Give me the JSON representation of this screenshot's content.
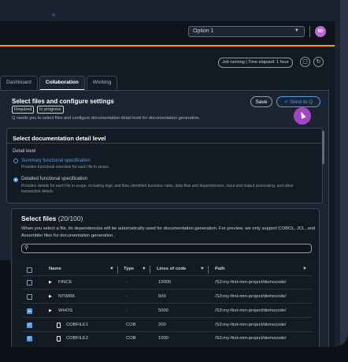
{
  "topbar": {
    "option_value": "Option 1",
    "avatar_initials": "SD"
  },
  "status": {
    "job": "Job running  |  Time elapsed: 1 hour"
  },
  "tabs": [
    "Dashboard",
    "Collaboration",
    "Worklog"
  ],
  "select_section": {
    "title": "Select files and configure settings",
    "badges": [
      "Required",
      "In progress"
    ],
    "description": "Q needs you to select files and configure documentation detail level for documentation generation.",
    "save_label": "Save",
    "send_label": "Send to Q"
  },
  "doc_level": {
    "title": "Select documentation detail level",
    "detail_label": "Detail level",
    "options": [
      {
        "label": "Summary functional specification",
        "desc": "Provides functional overview for each file in scope."
      },
      {
        "label": "Detailed functional specification",
        "desc": "Provides details for each file in scope, including logic and flow, identified business rules, data flow and dependencies, input and output processing, and other transaction details."
      }
    ]
  },
  "files": {
    "title": "Select files",
    "count": "(20/100)",
    "description": "When you select a file, its dependencies will be automatically used for documentation generation.  For preview, we only support COBOL, JCL, and Assembler files for documentation generation.",
    "columns": [
      "Name",
      "Type",
      "Lines of code",
      "Path"
    ],
    "rows": [
      {
        "name": "FINCE",
        "type": "-",
        "loc": "10000",
        "path": "/S3:my-first-mm-project/democode/"
      },
      {
        "name": "NTWRK",
        "type": "-",
        "loc": "500",
        "path": "/S3:my-first-mm-project/democode/"
      },
      {
        "name": "WHOS",
        "type": "-",
        "loc": "5000",
        "path": "/S3:my-first-mm-project/democode/"
      },
      {
        "name": "COBFILE1",
        "type": "COB",
        "loc": "200",
        "path": "/S3:my-first-mm-project/democode/"
      },
      {
        "name": "COBFILE2",
        "type": "COB",
        "loc": "1000",
        "path": "/S3:my-first-mm-project/democode/"
      }
    ]
  }
}
